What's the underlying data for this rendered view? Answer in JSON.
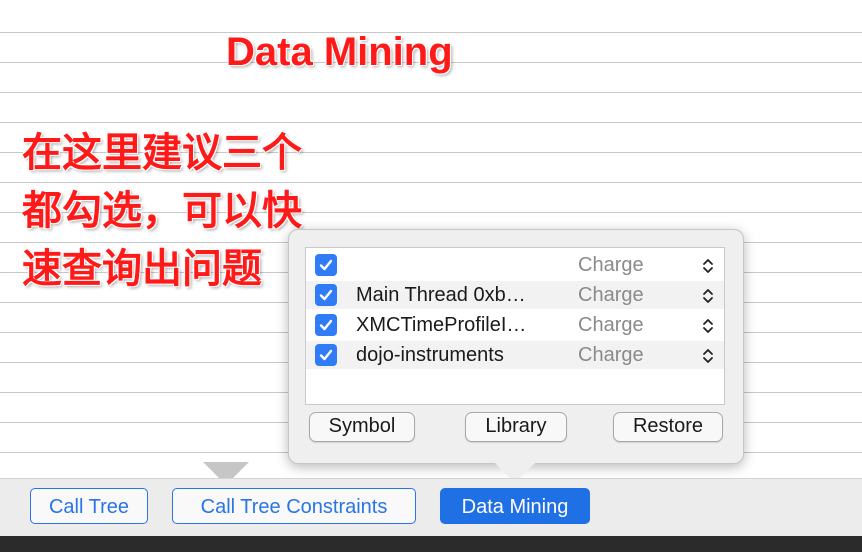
{
  "annotation": {
    "title": "Data Mining",
    "note": "在这里建议三个都勾选，可以快速查询出问题",
    "color": "#ff1a1a"
  },
  "popover": {
    "rows": [
      {
        "checked": true,
        "name": "",
        "charge": "Charge"
      },
      {
        "checked": true,
        "name": "Main Thread  0xb…",
        "charge": "Charge"
      },
      {
        "checked": true,
        "name": "XMCTimeProfileI…",
        "charge": "Charge"
      },
      {
        "checked": true,
        "name": "dojo-instruments",
        "charge": "Charge"
      }
    ],
    "buttons": {
      "symbol": "Symbol",
      "library": "Library",
      "restore": "Restore"
    }
  },
  "tabs": [
    {
      "label": "Call Tree",
      "active": false
    },
    {
      "label": "Call Tree Constraints",
      "active": false
    },
    {
      "label": "Data Mining",
      "active": true
    }
  ],
  "colors": {
    "accent": "#1f6fe5",
    "checkbox": "#2f7cf6"
  },
  "icons": {
    "checkbox": "checkmark-icon",
    "stepper": "up-down-chevron-icon"
  }
}
